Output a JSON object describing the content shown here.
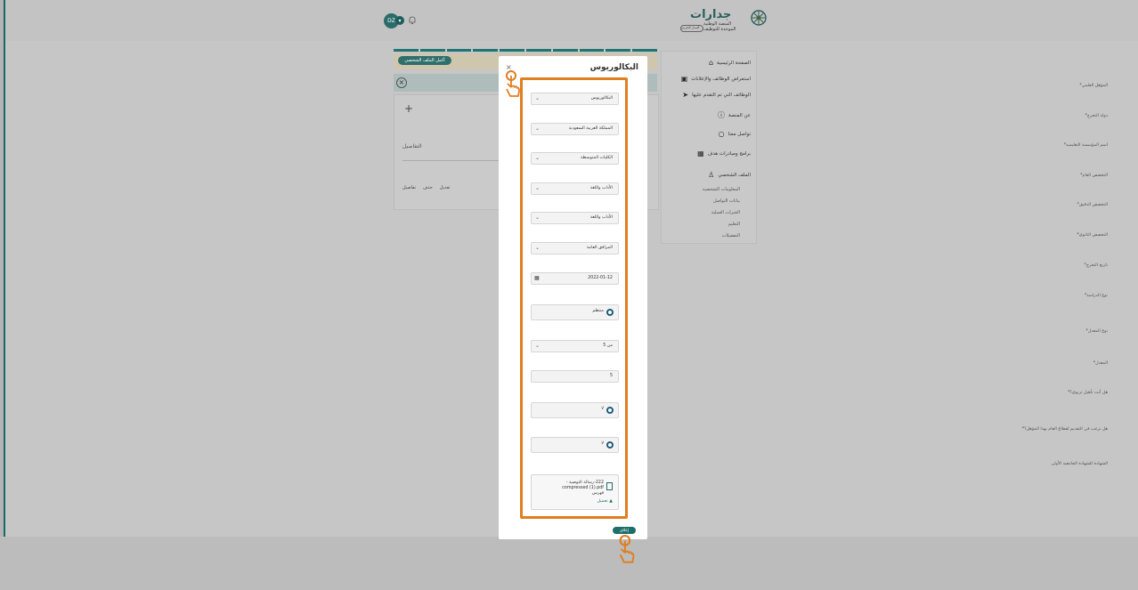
{
  "header": {
    "avatar_initials": "DZ",
    "logo_title": "جدارات",
    "logo_sub1": "المنصة الوطنية",
    "logo_sub2": "الموحدة للتوظيف",
    "logo_badge": "الإصدار التجريبي"
  },
  "profile_card": {
    "complete_button": "أكمل الملف الشخصي",
    "details_label": "التفاصيل",
    "row_actions": [
      "تفاصيل",
      "حذف",
      "تعديل"
    ]
  },
  "sidebar": {
    "items": [
      {
        "label": "الصفحة الرئيسية",
        "icon": "home-icon"
      },
      {
        "label": "استعراض الوظائف والإعلانات",
        "icon": "briefcase-icon"
      },
      {
        "label": "الوظائف التي تم التقدم عليها",
        "icon": "send-icon"
      },
      {
        "label": "عن المنصة",
        "icon": "info-icon"
      },
      {
        "label": "تواصل معنا",
        "icon": "chat-icon"
      },
      {
        "label": "برامج ومبادرات هدف",
        "icon": "grid-icon"
      },
      {
        "label": "الملف الشخصي",
        "icon": "user-icon"
      }
    ],
    "sub_items": [
      "المعلومات الشخصية",
      "بيانات التواصل",
      "الخبرات العملية",
      "التعليم",
      "التفضيلات"
    ]
  },
  "modal": {
    "title": "البكالوريوس",
    "fields": [
      {
        "label": "المؤهل العلمي*",
        "value": "البكالوريوس",
        "type": "select"
      },
      {
        "label": "دولة التخرج*",
        "value": "المملكة العربية السعودية",
        "type": "select"
      },
      {
        "label": "اسم المؤسسة التعليمية*",
        "value": "الكليات المتوسطة",
        "type": "select"
      },
      {
        "label": "التخصص العام*",
        "value": "الأداب واللغة",
        "type": "select"
      },
      {
        "label": "التخصص الدقيق*",
        "value": "الأداب واللغة",
        "type": "select"
      },
      {
        "label": "التخصص الثانوي*",
        "value": "المرافق العامة",
        "type": "select"
      },
      {
        "label": "تاريخ التخرج*",
        "value": "2022-01-12",
        "type": "date"
      },
      {
        "label": "نوع الدراسة*",
        "value": "منتظم",
        "type": "radio"
      },
      {
        "label": "نوع المعدل*",
        "value": "من 5",
        "type": "select"
      },
      {
        "label": "المعدل*",
        "value": "5",
        "type": "text"
      },
      {
        "label": "هل أنت تأهيل تربوي؟*",
        "value": "لا",
        "type": "radio"
      },
      {
        "label": "هل ترغب في التقديم لقطاع العام بهذا المؤهل؟*",
        "value": "لا",
        "type": "radio"
      }
    ],
    "attachment_label": "الشهادة للشهادة الجامعية الأولى",
    "file_name": "222-رسالة التوصية - compressed (1).pdf فهرس",
    "download_label": "تحميل",
    "close_button": "إغلاق"
  },
  "colors": {
    "brand_teal": "#1e6e6a",
    "highlight_orange": "#e07e20"
  }
}
